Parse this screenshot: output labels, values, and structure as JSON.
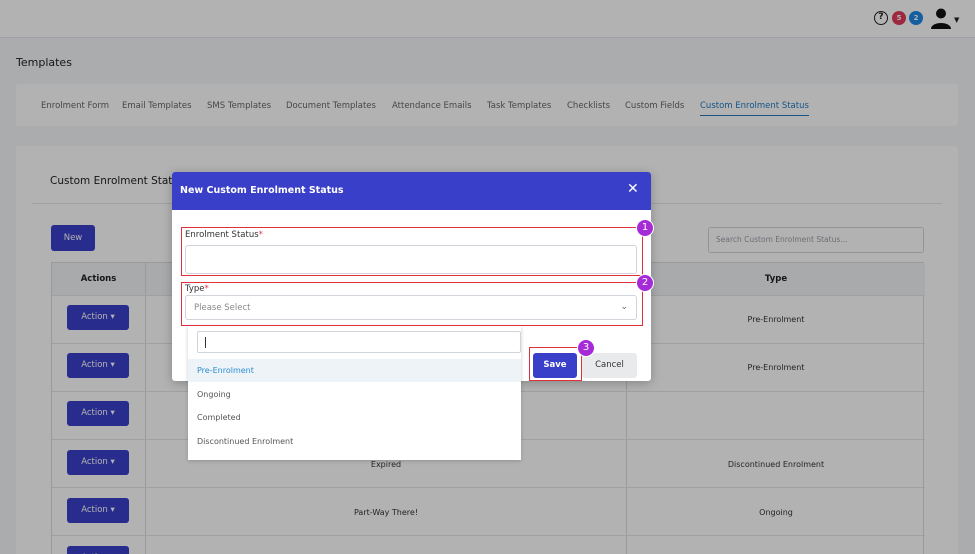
{
  "topbar": {
    "help_glyph": "?",
    "notifications_count": "5",
    "messages_count": "2",
    "icons": [
      "help-circle-icon",
      "user-avatar-icon",
      "caret-down-icon"
    ]
  },
  "page": {
    "title": "Templates"
  },
  "tabs": [
    {
      "label": "Enrolment Form"
    },
    {
      "label": "Email Templates"
    },
    {
      "label": "SMS Templates"
    },
    {
      "label": "Document Templates"
    },
    {
      "label": "Attendance Emails"
    },
    {
      "label": "Task Templates"
    },
    {
      "label": "Checklists"
    },
    {
      "label": "Custom Fields"
    },
    {
      "label": "Custom Enrolment Status",
      "active": true
    }
  ],
  "section": {
    "title": "Custom Enrolment Status",
    "new_label": "New",
    "search_placeholder": "Search Custom Enrolment Status..."
  },
  "table": {
    "headers": {
      "actions": "Actions",
      "type": "Type"
    },
    "action_label": "Action",
    "rows": [
      {
        "status": "",
        "type": "Pre-Enrolment"
      },
      {
        "status": "",
        "type": "Pre-Enrolment"
      },
      {
        "status": "",
        "type": ""
      },
      {
        "status": "Expired",
        "type": "Discontinued Enrolment"
      },
      {
        "status": "Part-Way There!",
        "type": "Ongoing"
      },
      {
        "status": "",
        "type": ""
      }
    ]
  },
  "modal": {
    "title": "New Custom Enrolment Status",
    "close_glyph": "✕",
    "status_label": "Enrolment Status",
    "type_label": "Type",
    "required_mark": "*",
    "type_placeholder": "Please Select",
    "save_label": "Save",
    "cancel_label": "Cancel"
  },
  "dropdown": {
    "options": [
      "Pre-Enrolment",
      "Ongoing",
      "Completed",
      "Discontinued Enrolment"
    ],
    "selected_index": 0
  },
  "annotations": {
    "markers": [
      "1",
      "2",
      "3"
    ],
    "highlight_color": "#e0303b",
    "marker_color": "#a52bd8"
  },
  "colors": {
    "primary": "#3a3fc9",
    "link_active": "#1e7bc4",
    "badge_red": "#e03b5a",
    "badge_blue": "#1e88e5"
  }
}
